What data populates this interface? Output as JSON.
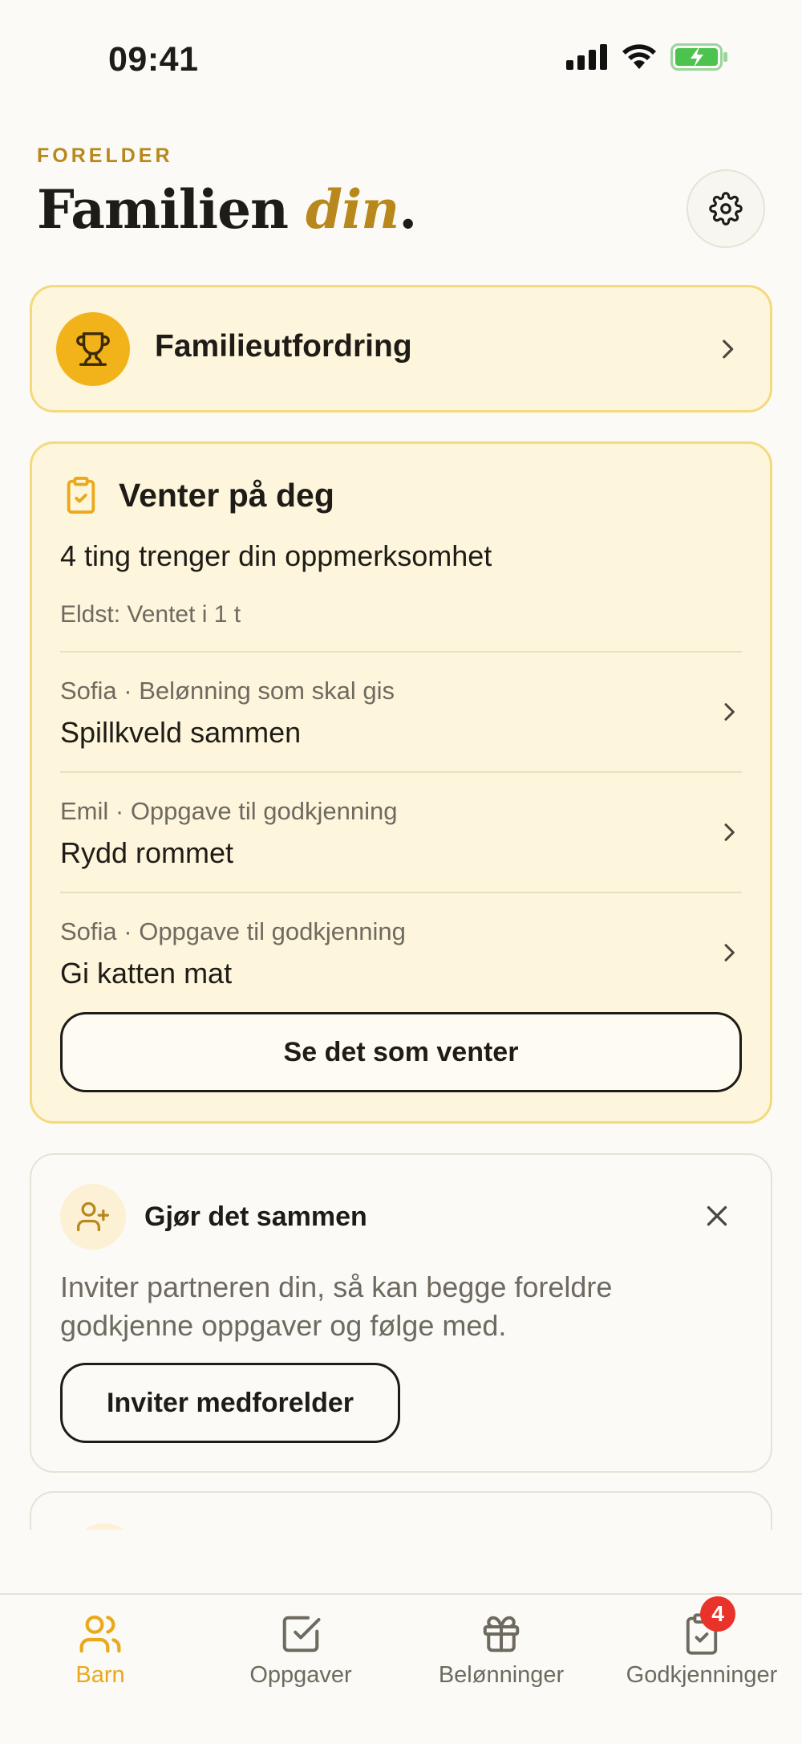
{
  "status_bar": {
    "time": "09:41",
    "icons": [
      "signal-icon",
      "wifi-icon",
      "battery-charging-icon"
    ]
  },
  "header": {
    "eyebrow": "FORELDER",
    "title_main": "Familien ",
    "title_accent": "din",
    "title_end": ".",
    "settings_icon": "gear-icon"
  },
  "challenge": {
    "label": "Familieutfordring",
    "icon": "trophy-icon"
  },
  "waiting": {
    "icon": "clipboard-check-icon",
    "title": "Venter på deg",
    "subtitle": "4 ting trenger din oppmerksomhet",
    "oldest": "Eldst: Ventet i 1 t",
    "items": [
      {
        "meta": "Sofia · Belønning som skal gis",
        "title": "Spillkveld sammen"
      },
      {
        "meta": "Emil · Oppgave til godkjenning",
        "title": "Rydd rommet"
      },
      {
        "meta": "Sofia · Oppgave til godkjenning",
        "title": "Gi katten mat"
      }
    ],
    "button_label": "Se det som venter"
  },
  "together": {
    "icon": "user-plus-icon",
    "title": "Gjør det sammen",
    "text": "Inviter partneren din, så kan begge foreldre godkjenne oppgaver og følge med.",
    "button_label": "Inviter medforelder"
  },
  "tabs": [
    {
      "label": "Barn",
      "icon": "users-icon",
      "active": true
    },
    {
      "label": "Oppgaver",
      "icon": "checkbox-icon",
      "active": false
    },
    {
      "label": "Belønninger",
      "icon": "gift-icon",
      "active": false
    },
    {
      "label": "Godkjenninger",
      "icon": "clipboard-check-icon",
      "active": false,
      "badge": "4"
    }
  ],
  "colors": {
    "accent": "#b8881c",
    "tab_active": "#e9a91a",
    "card_bg": "#fdf6dc",
    "badge": "#e8322a"
  }
}
